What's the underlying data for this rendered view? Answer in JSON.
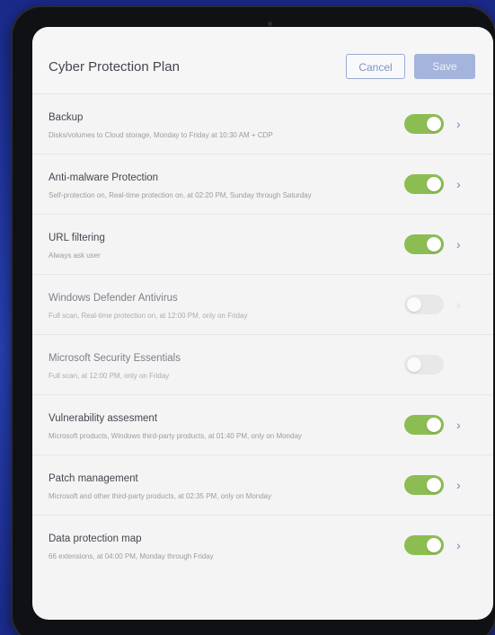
{
  "header": {
    "title": "Cyber Protection Plan",
    "cancel_label": "Cancel",
    "save_label": "Save"
  },
  "items": [
    {
      "title": "Backup",
      "subtitle": "Disks/volumes to Cloud storage, Monday to Friday at 10:30 AM + CDP",
      "enabled": true,
      "chevron": "chevron-right-icon"
    },
    {
      "title": "Anti-malware Protection",
      "subtitle": "Self-protection on, Real-time protection on, at 02:20 PM, Sunday through Saturday",
      "enabled": true,
      "chevron": "chevron-right-icon"
    },
    {
      "title": "URL filtering",
      "subtitle": "Always ask user",
      "enabled": true,
      "chevron": "chevron-right-icon"
    },
    {
      "title": "Windows Defender Antivirus",
      "subtitle": "Full scan, Real-time protection on, at 12:00 PM, only on Friday",
      "enabled": false,
      "chevron": "chevron-right-icon"
    },
    {
      "title": "Microsoft Security Essentials",
      "subtitle": "Full scan, at 12:00 PM, only on Friday",
      "enabled": false,
      "chevron": null
    },
    {
      "title": "Vulnerability assesment",
      "subtitle": "Microsoft products, Windows third-party products, at 01:40 PM, only on Monday",
      "enabled": true,
      "chevron": "chevron-right-icon"
    },
    {
      "title": "Patch management",
      "subtitle": "Microsoft and other third-party products, at 02:35 PM, only on Monday",
      "enabled": true,
      "chevron": "chevron-right-icon"
    },
    {
      "title": "Data protection map",
      "subtitle": "66 extensions, at 04:00 PM, Monday through Friday",
      "enabled": true,
      "chevron": "chevron-right-icon"
    }
  ],
  "colors": {
    "toggle_on": "#8cbd52",
    "toggle_off": "#e8e8ea",
    "accent": "#6c86c4",
    "background": "#1d2f8c"
  }
}
